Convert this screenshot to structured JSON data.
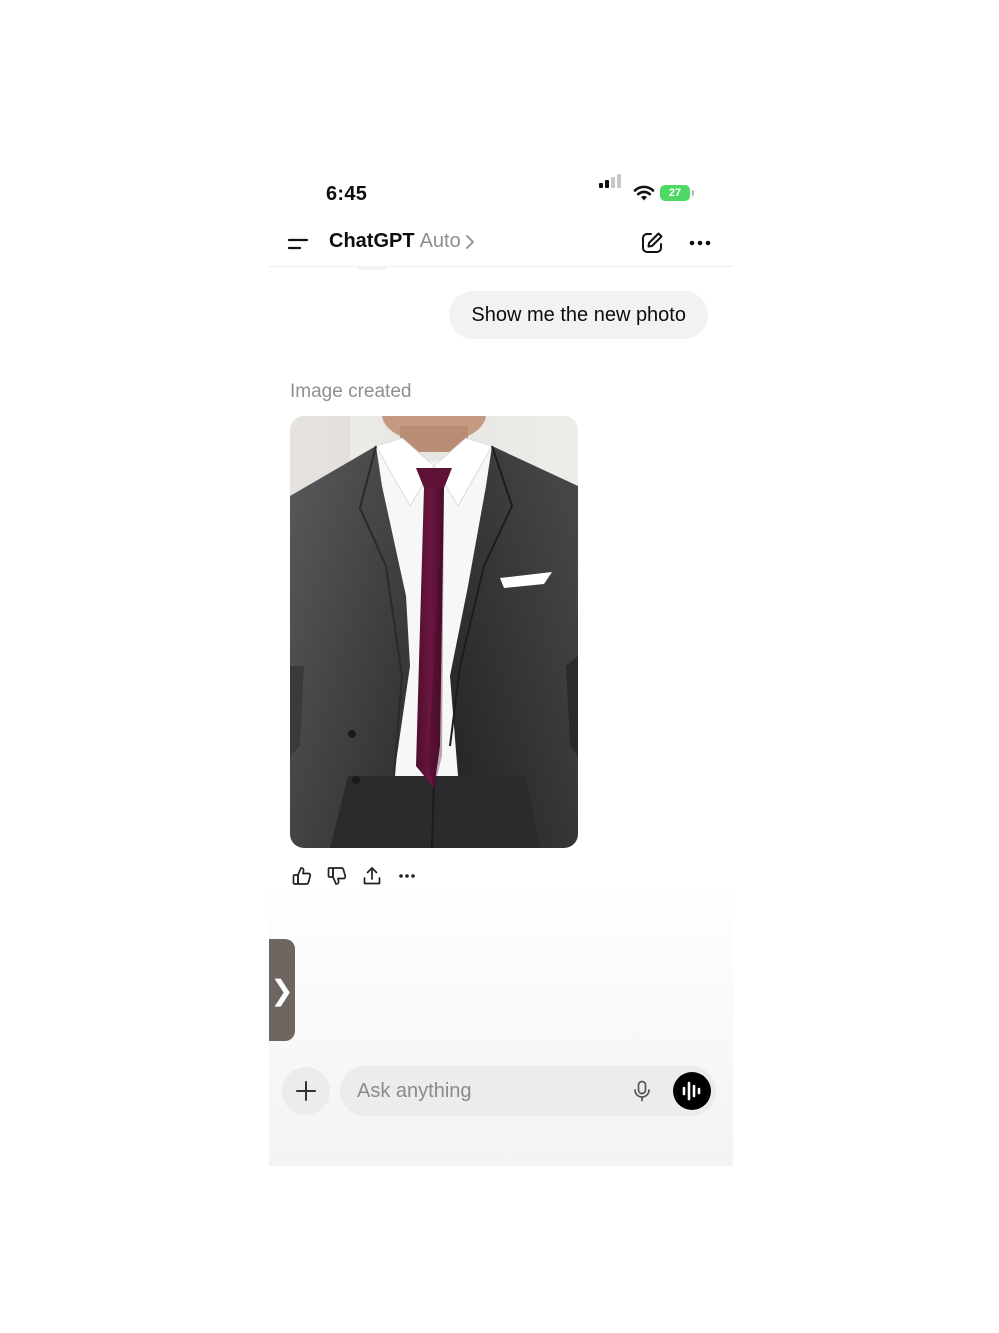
{
  "status_bar": {
    "time": "6:45",
    "battery": "27",
    "battery_color": "#4cd964"
  },
  "header": {
    "title": "ChatGPT",
    "model": "Auto",
    "menu_icon": "sidebar-menu-icon",
    "compose_icon": "new-chat-icon",
    "more_icon": "more-icon"
  },
  "conversation": {
    "user_message": "Show me the new photo",
    "assistant_label": "Image created",
    "image_alt": "man in charcoal suit with burgundy tie",
    "actions": [
      "thumbs-up-icon",
      "thumbs-down-icon",
      "share-icon",
      "more-icon"
    ]
  },
  "composer": {
    "placeholder": "Ask anything",
    "plus_icon": "plus-icon",
    "mic_icon": "microphone-icon",
    "voice_icon": "voice-mode-icon"
  },
  "drawer_handle": {
    "glyph": "❯"
  }
}
